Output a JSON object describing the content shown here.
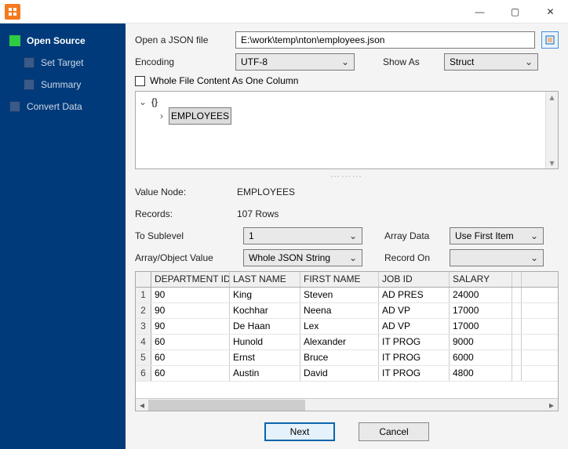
{
  "window": {
    "min": "—",
    "max": "▢",
    "close": "✕"
  },
  "sidebar": {
    "items": [
      {
        "label": "Open Source",
        "active": true
      },
      {
        "label": "Set Target",
        "active": false
      },
      {
        "label": "Summary",
        "active": false
      },
      {
        "label": "Convert Data",
        "active": false
      }
    ]
  },
  "form": {
    "open_label": "Open a JSON file",
    "path": "E:\\work\\temp\\nton\\employees.json",
    "encoding_label": "Encoding",
    "encoding_value": "UTF-8",
    "showas_label": "Show As",
    "showas_value": "Struct",
    "whole_label": "Whole File Content As One Column",
    "tree_root": "{}",
    "tree_child": "EMPLOYEES",
    "value_node_label": "Value Node:",
    "value_node": "EMPLOYEES",
    "records_label": "Records:",
    "records": "107 Rows",
    "sublevel_label": "To Sublevel",
    "sublevel_value": "1",
    "arraydata_label": "Array Data",
    "arraydata_value": "Use First Item",
    "arrobj_label": "Array/Object Value",
    "arrobj_value": "Whole JSON String",
    "recordon_label": "Record On",
    "recordon_value": ""
  },
  "grid": {
    "columns": [
      "DEPARTMENT ID",
      "LAST NAME",
      "FIRST NAME",
      "JOB ID",
      "SALARY"
    ],
    "rows": [
      [
        "90",
        "King",
        "Steven",
        "AD PRES",
        "24000"
      ],
      [
        "90",
        "Kochhar",
        "Neena",
        "AD VP",
        "17000"
      ],
      [
        "90",
        "De Haan",
        "Lex",
        "AD VP",
        "17000"
      ],
      [
        "60",
        "Hunold",
        "Alexander",
        "IT PROG",
        "9000"
      ],
      [
        "60",
        "Ernst",
        "Bruce",
        "IT PROG",
        "6000"
      ],
      [
        "60",
        "Austin",
        "David",
        "IT PROG",
        "4800"
      ]
    ]
  },
  "footer": {
    "next": "Next",
    "cancel": "Cancel"
  }
}
